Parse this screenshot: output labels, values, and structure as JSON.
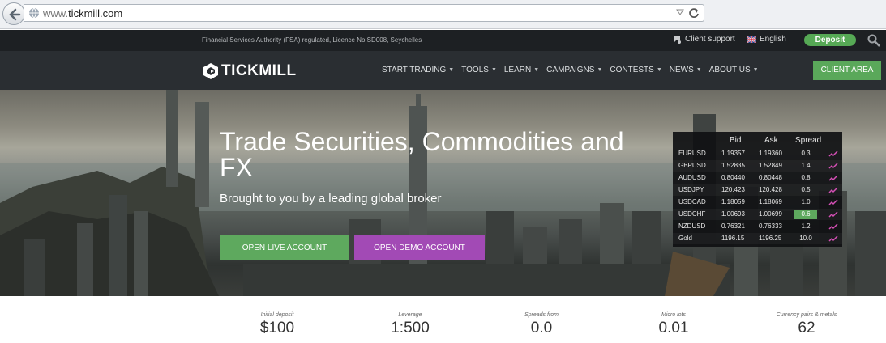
{
  "browser": {
    "url_prefix": "www.",
    "url_domain": "tickmill.com"
  },
  "topbar": {
    "regulation": "Financial Services Authority (FSA) regulated, Licence No SD008, Seychelles",
    "support": "Client support",
    "language": "English",
    "deposit": "Deposit"
  },
  "nav": {
    "logo": "TICKMILL",
    "items": [
      "START TRADING",
      "TOOLS",
      "LEARN",
      "CAMPAIGNS",
      "CONTESTS",
      "NEWS",
      "ABOUT US"
    ],
    "client_area": "CLIENT AREA"
  },
  "hero": {
    "title": "Trade Securities, Commodities and FX",
    "subtitle": "Brought to you by a leading global broker",
    "live_btn": "OPEN LIVE ACCOUNT",
    "demo_btn": "OPEN DEMO ACCOUNT"
  },
  "quotes": {
    "headers": {
      "bid": "Bid",
      "ask": "Ask",
      "spread": "Spread"
    },
    "rows": [
      {
        "symbol": "EURUSD",
        "bid": "1.19357",
        "ask": "1.19360",
        "spread": "0.3",
        "highlight": false
      },
      {
        "symbol": "GBPUSD",
        "bid": "1.52835",
        "ask": "1.52849",
        "spread": "1.4",
        "highlight": false
      },
      {
        "symbol": "AUDUSD",
        "bid": "0.80440",
        "ask": "0.80448",
        "spread": "0.8",
        "highlight": false
      },
      {
        "symbol": "USDJPY",
        "bid": "120.423",
        "ask": "120.428",
        "spread": "0.5",
        "highlight": false
      },
      {
        "symbol": "USDCAD",
        "bid": "1.18059",
        "ask": "1.18069",
        "spread": "1.0",
        "highlight": false
      },
      {
        "symbol": "USDCHF",
        "bid": "1.00693",
        "ask": "1.00699",
        "spread": "0.6",
        "highlight": true
      },
      {
        "symbol": "NZDUSD",
        "bid": "0.76321",
        "ask": "0.76333",
        "spread": "1.2",
        "highlight": false
      },
      {
        "symbol": "Gold",
        "bid": "1196.15",
        "ask": "1196.25",
        "spread": "10.0",
        "highlight": false
      }
    ]
  },
  "stats": [
    {
      "label": "Initial deposit",
      "value": "$100"
    },
    {
      "label": "Leverage",
      "value": "1:500"
    },
    {
      "label": "Spreads from",
      "value": "0.0"
    },
    {
      "label": "Micro lots",
      "value": "0.01"
    },
    {
      "label": "Currency pairs & metals",
      "value": "62"
    }
  ],
  "colors": {
    "green": "#5ea95e",
    "purple": "#a24ab5",
    "dark": "#2a2e32"
  }
}
